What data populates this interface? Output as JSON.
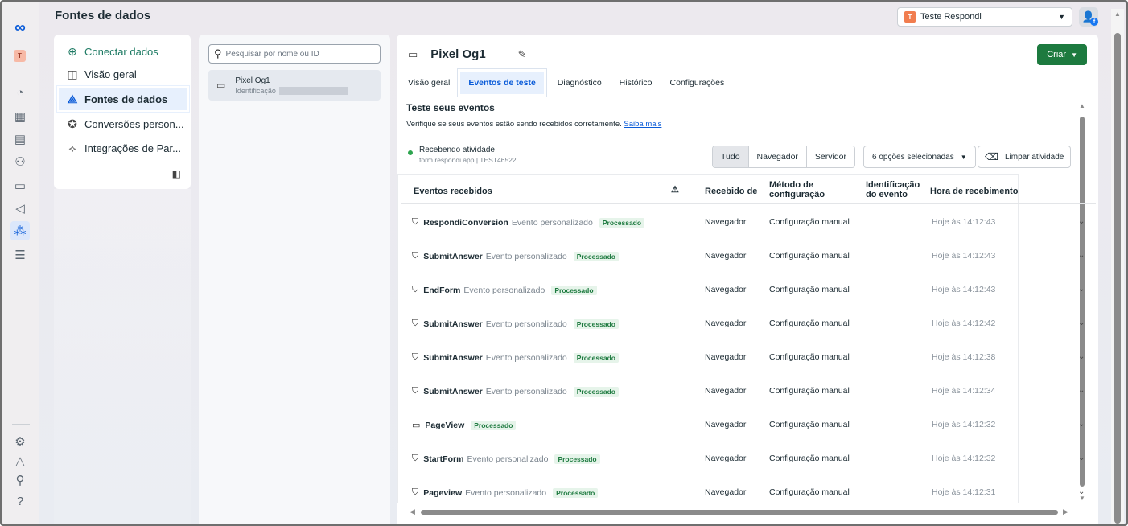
{
  "header": {
    "title": "Fontes de dados",
    "account": {
      "badge": "T",
      "name": "Teste Respondi"
    }
  },
  "leftnav": {
    "logo": "∞",
    "avatar": "T"
  },
  "sidebar": {
    "items": [
      {
        "label": "Conectar dados",
        "icon": "plus-circle-icon"
      },
      {
        "label": "Visão geral",
        "icon": "overview-icon"
      },
      {
        "label": "Fontes de dados",
        "icon": "data-sources-icon"
      },
      {
        "label": "Conversões person...",
        "icon": "star-badge-icon"
      },
      {
        "label": "Integrações de Par...",
        "icon": "handshake-icon"
      }
    ]
  },
  "pixel_list": {
    "search_placeholder": "Pesquisar por nome ou ID",
    "pixel_name": "Pixel Og1",
    "pixel_id_label": "Identificação"
  },
  "main": {
    "pixel_name": "Pixel Og1",
    "create_label": "Criar",
    "tabs": [
      "Visão geral",
      "Eventos de teste",
      "Diagnóstico",
      "Histórico",
      "Configurações"
    ],
    "section_title": "Teste seus eventos",
    "section_desc": "Verifique se seus eventos estão sendo recebidos corretamente.",
    "learn_more": "Saiba mais",
    "status": {
      "label": "Recebendo atividade",
      "source": "form.respondi.app   |   TEST46522"
    },
    "filters": [
      "Tudo",
      "Navegador",
      "Servidor"
    ],
    "options_label": "6 opções selecionadas",
    "clear_label": "Limpar atividade",
    "table": {
      "headers": {
        "events": "Eventos recebidos",
        "warn": "⚠",
        "received_from": "Recebido de",
        "setup_method_1": "Método de",
        "setup_method_2": "configuração",
        "event_id_1": "Identificação",
        "event_id_2": "do evento",
        "time": "Hora de recebimento"
      },
      "rows": [
        {
          "name": "RespondiConversion",
          "type": "Evento personalizado",
          "status": "Processado",
          "from": "Navegador",
          "method": "Configuração manual",
          "time": "Hoje às 14:12:43",
          "icon": "tag-icon"
        },
        {
          "name": "SubmitAnswer",
          "type": "Evento personalizado",
          "status": "Processado",
          "from": "Navegador",
          "method": "Configuração manual",
          "time": "Hoje às 14:12:43",
          "icon": "tag-icon"
        },
        {
          "name": "EndForm",
          "type": "Evento personalizado",
          "status": "Processado",
          "from": "Navegador",
          "method": "Configuração manual",
          "time": "Hoje às 14:12:43",
          "icon": "tag-icon"
        },
        {
          "name": "SubmitAnswer",
          "type": "Evento personalizado",
          "status": "Processado",
          "from": "Navegador",
          "method": "Configuração manual",
          "time": "Hoje às 14:12:42",
          "icon": "tag-icon"
        },
        {
          "name": "SubmitAnswer",
          "type": "Evento personalizado",
          "status": "Processado",
          "from": "Navegador",
          "method": "Configuração manual",
          "time": "Hoje às 14:12:38",
          "icon": "tag-icon"
        },
        {
          "name": "SubmitAnswer",
          "type": "Evento personalizado",
          "status": "Processado",
          "from": "Navegador",
          "method": "Configuração manual",
          "time": "Hoje às 14:12:34",
          "icon": "tag-icon"
        },
        {
          "name": "PageView",
          "type": "",
          "status": "Processado",
          "from": "Navegador",
          "method": "Configuração manual",
          "time": "Hoje às 14:12:32",
          "icon": "browser-window-icon"
        },
        {
          "name": "StartForm",
          "type": "Evento personalizado",
          "status": "Processado",
          "from": "Navegador",
          "method": "Configuração manual",
          "time": "Hoje às 14:12:32",
          "icon": "tag-icon"
        },
        {
          "name": "Pageview",
          "type": "Evento personalizado",
          "status": "Processado",
          "from": "Navegador",
          "method": "Configuração manual",
          "time": "Hoje às 14:12:31",
          "icon": "tag-icon"
        }
      ]
    }
  },
  "colors": {
    "accent": "#0a5bd8",
    "create_button": "#1d7a3f",
    "processed_badge_bg": "#e6f4ea"
  }
}
